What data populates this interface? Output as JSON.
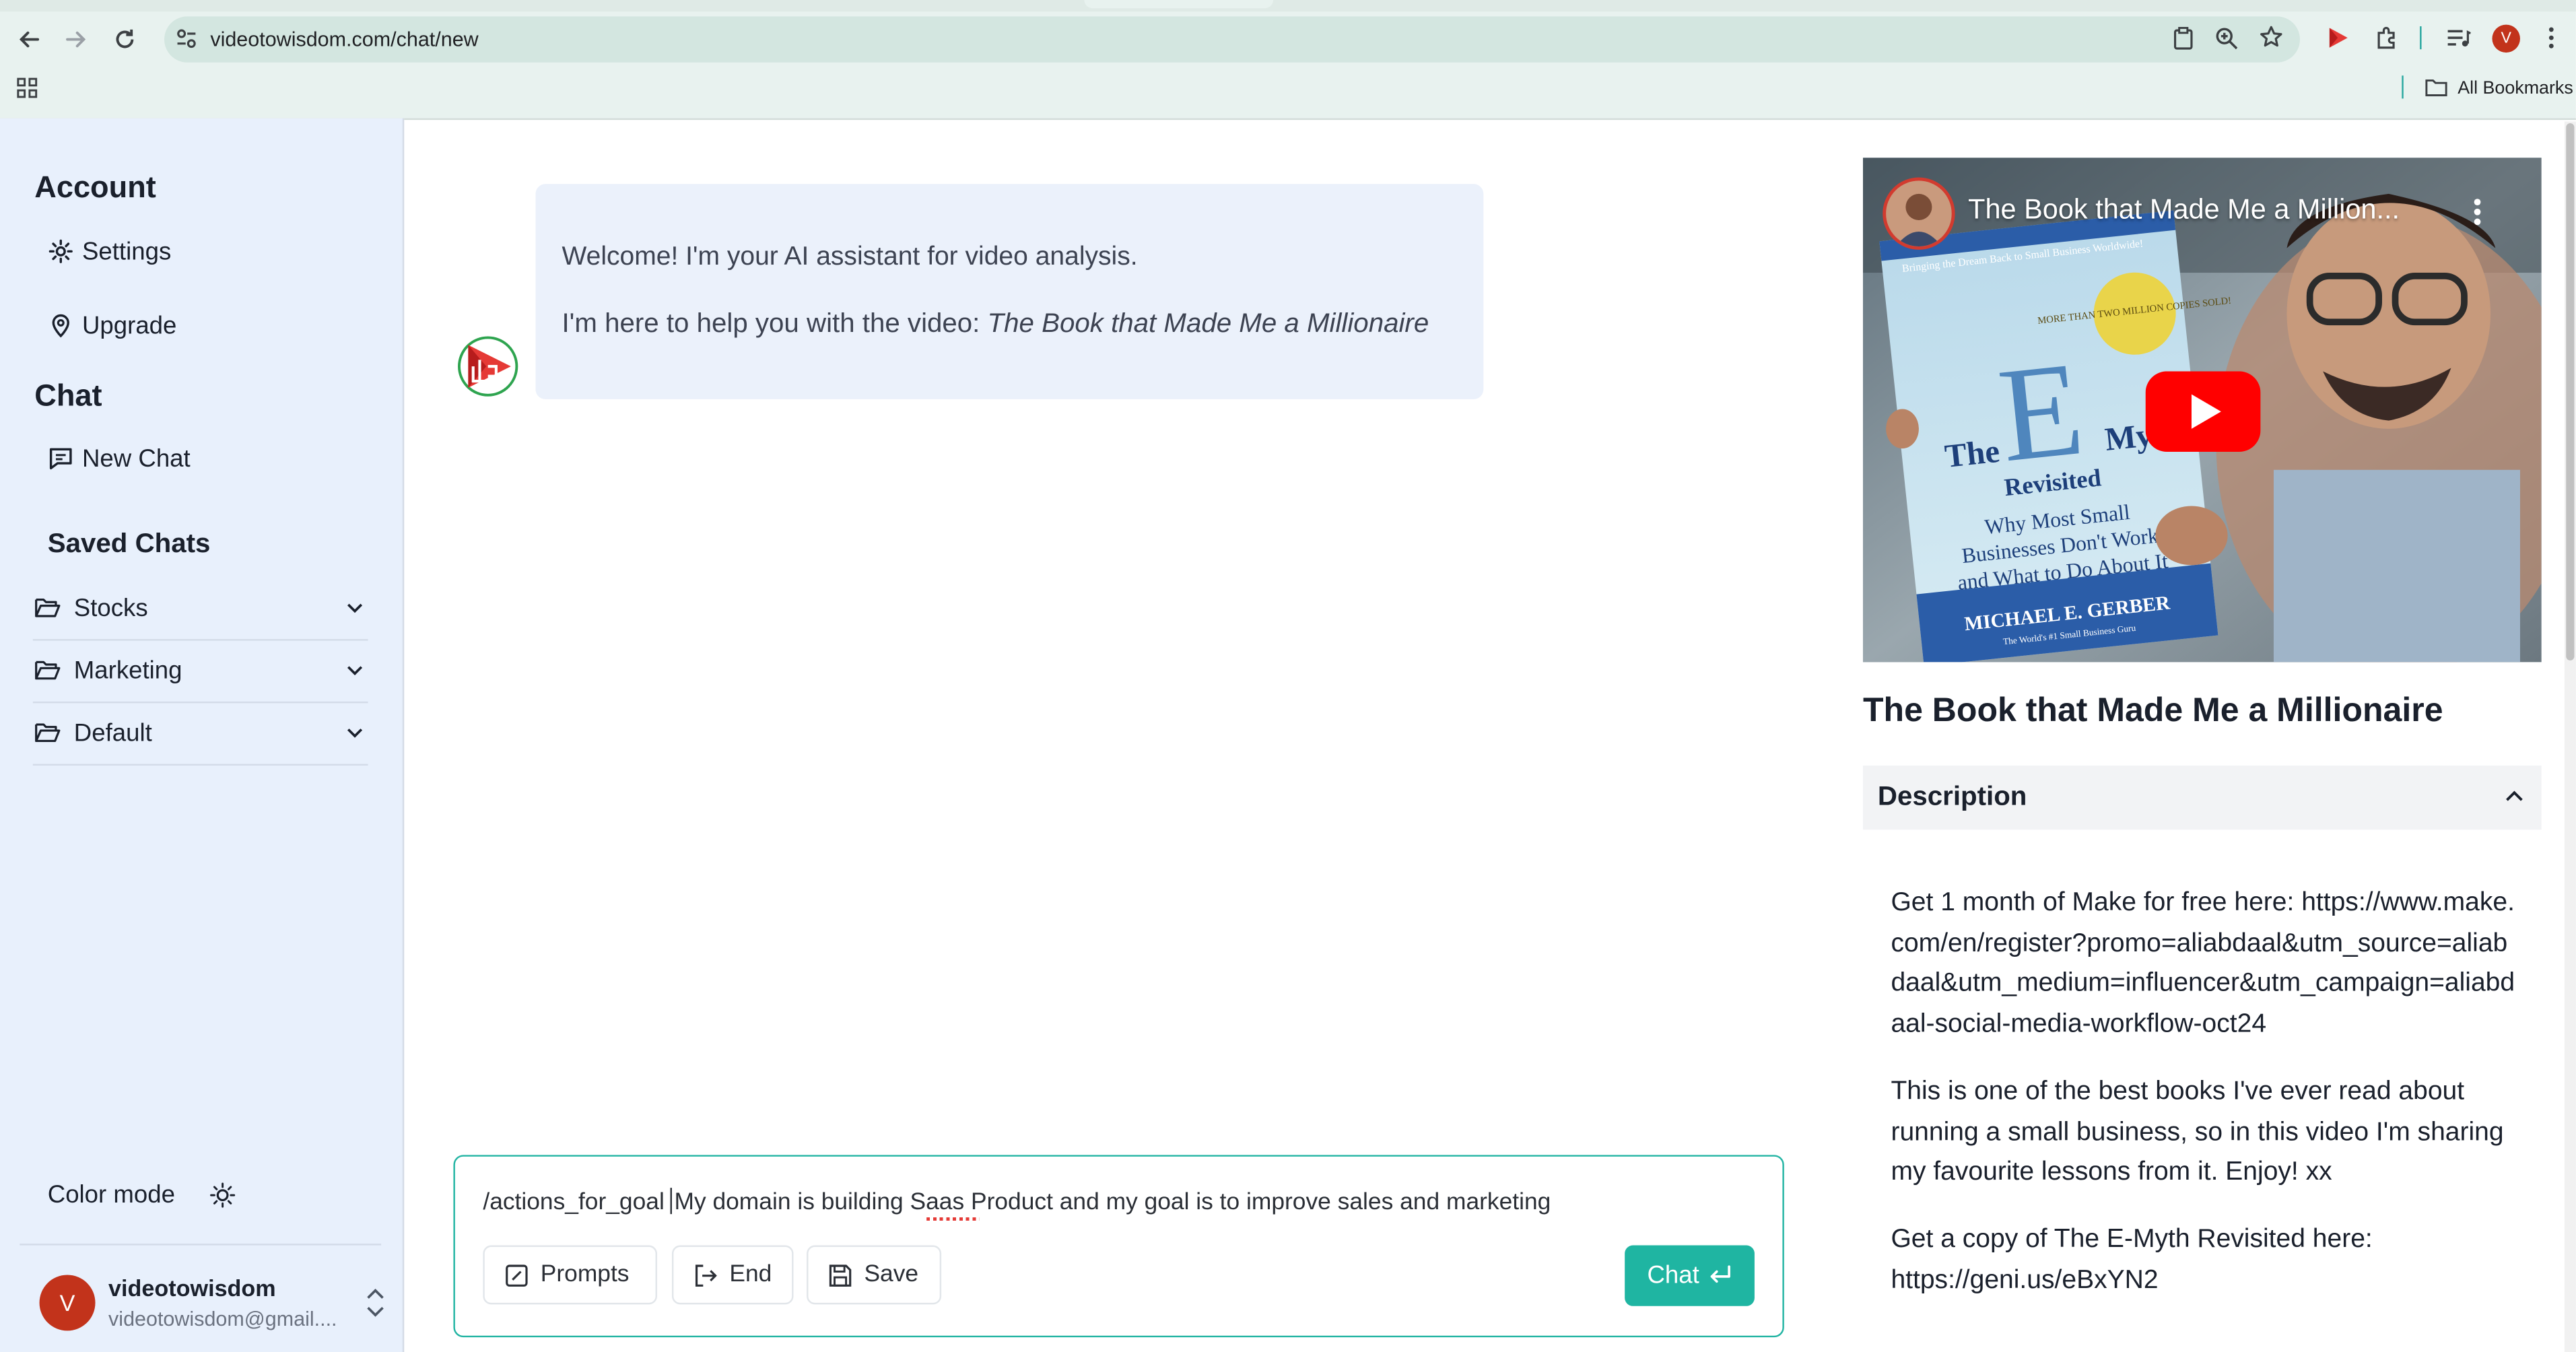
{
  "browser": {
    "url": "videotowisdom.com/chat/new",
    "bookmarks_label": "All Bookmarks",
    "profile_initial": "V"
  },
  "sidebar": {
    "account_title": "Account",
    "settings_label": "Settings",
    "upgrade_label": "Upgrade",
    "chat_title": "Chat",
    "new_chat_label": "New Chat",
    "saved_chats_title": "Saved Chats",
    "folders": [
      {
        "label": "Stocks"
      },
      {
        "label": "Marketing"
      },
      {
        "label": "Default"
      }
    ],
    "color_mode_label": "Color mode",
    "user": {
      "initial": "V",
      "name": "videotowisdom",
      "email": "videotowisdom@gmail...."
    }
  },
  "chat": {
    "welcome": "Welcome! I'm your AI assistant for video analysis.",
    "helping_prefix": "I'm here to help you with the video: ",
    "video_name": "The Book that Made Me a Millionaire",
    "input_command": "/actions_for_goal",
    "input_text": "My domain is building Saas Product and my goal is to improve sales and marketing",
    "buttons": {
      "prompts": "Prompts",
      "end": "End",
      "save": "Save",
      "chat": "Chat"
    }
  },
  "video_panel": {
    "player_title": "The Book that Made Me a Million...",
    "book": {
      "tagline": "Bringing the Dream Back to Small Business Worldwide!",
      "badge": "MORE THAN TWO MILLION COPIES SOLD!",
      "title_the": "The",
      "title_e": "E",
      "title_my": "My",
      "revisited": "Revisited",
      "subtitle_1": "Why Most Small",
      "subtitle_2": "Businesses Don't Work",
      "subtitle_3": "and What to Do About It",
      "author": "MICHAEL E. GERBER",
      "author_tag": "The World's #1 Small Business Guru"
    },
    "title": "The Book that Made Me a Millionaire",
    "description_label": "Description",
    "description": [
      "Get 1 month of Make for free here: https://www.make.com/en/register?promo=aliabdaal&utm_source=aliabdaal&utm_medium=influencer&utm_campaign=aliabdaal-social-media-workflow-oct24",
      "This is one of the best books I've ever read about running a small business, so in this video I'm sharing my favourite lessons from it. Enjoy! xx",
      "Get a copy of The E-Myth Revisited here: https://geni.us/eBxYN2"
    ]
  },
  "colors": {
    "accent": "#1fb5a2",
    "sidebar_bg": "#e8f0fc",
    "bubble_bg": "#ebf1fb",
    "avatar": "#c2331b"
  }
}
